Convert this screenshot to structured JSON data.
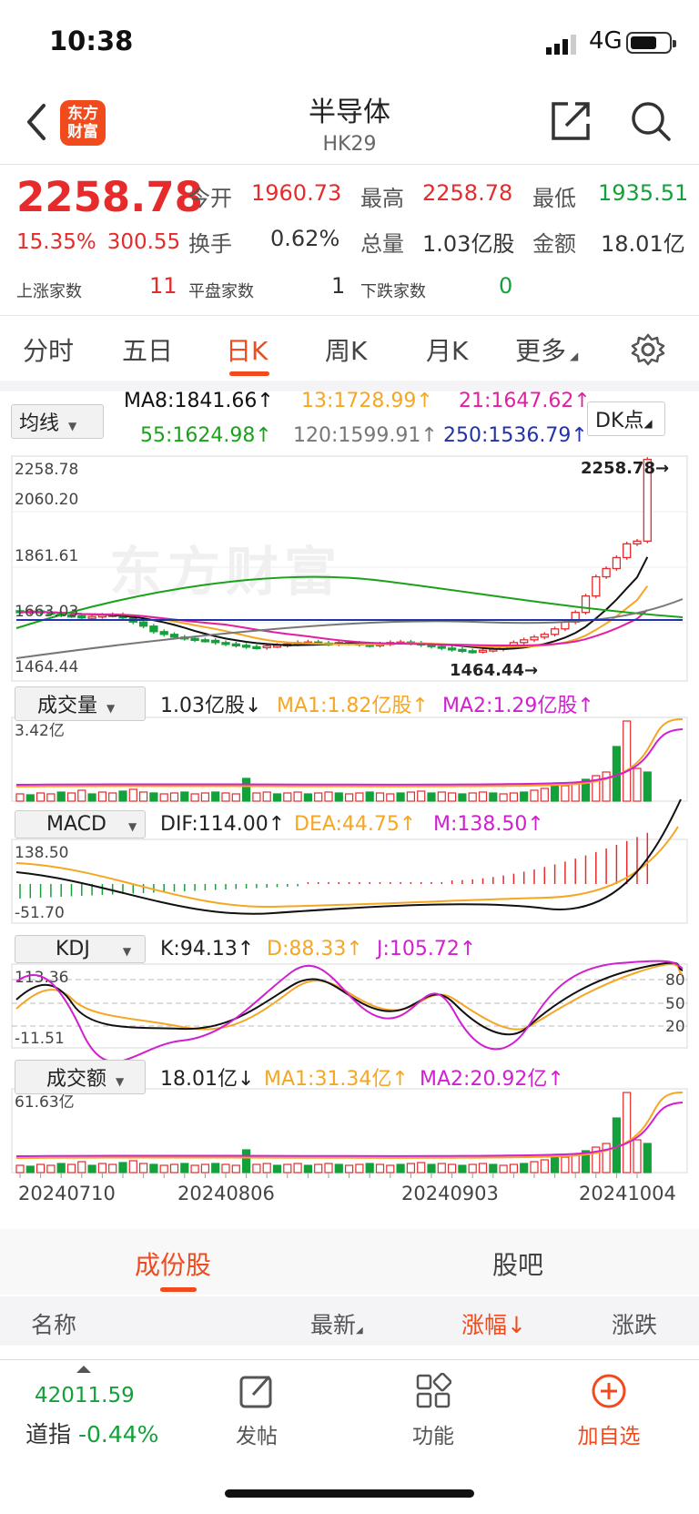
{
  "status_bar": {
    "time": "10:38",
    "network": "4G"
  },
  "header": {
    "title": "半导体",
    "code": "HK29",
    "logo_text": "东方财富"
  },
  "quote": {
    "price": "2258.78",
    "change_pct": "15.35%",
    "change": "300.55",
    "open_label": "今开",
    "open": "1960.73",
    "high_label": "最高",
    "high": "2258.78",
    "low_label": "最低",
    "low": "1935.51",
    "turnover_label": "换手",
    "turnover": "0.62%",
    "volume_label": "总量",
    "volume": "1.03亿股",
    "amount_label": "金额",
    "amount": "18.01亿",
    "up_label": "上涨家数",
    "up_count": "11",
    "flat_label": "平盘家数",
    "flat_count": "1",
    "down_label": "下跌家数",
    "down_count": "0"
  },
  "period_tabs": [
    "分时",
    "五日",
    "日K",
    "周K",
    "月K",
    "更多"
  ],
  "active_tab": "日K",
  "ma_panel": {
    "selector": "均线",
    "dk_label": "DK点",
    "ma8": "MA8:1841.66↑",
    "ma13": "13:1728.99↑",
    "ma21": "21:1647.62↑",
    "ma55": "55:1624.98↑",
    "ma120": "120:1599.91↑",
    "ma250": "250:1536.79↑"
  },
  "kline": {
    "y_labels": [
      "2258.78",
      "2060.20",
      "1861.61",
      "1663.03",
      "1464.44"
    ],
    "max_tag": "2258.78→",
    "min_tag": "1464.44→",
    "watermark": "东方财富",
    "colors": {
      "up": "#e52b2b",
      "down": "#13a13a",
      "ma8": "#111111",
      "ma13": "#f5a623",
      "ma21": "#e020a0",
      "ma55": "#1aa31a",
      "ma120": "#777777",
      "ma250": "#2233aa"
    }
  },
  "volume_panel": {
    "selector": "成交量",
    "value": "1.03亿股↓",
    "ma1": "MA1:1.82亿股↑",
    "ma2": "MA2:1.29亿股↑",
    "max": "3.42亿"
  },
  "macd_panel": {
    "selector": "MACD",
    "dif": "DIF:114.00↑",
    "dea": "DEA:44.75↑",
    "m": "M:138.50↑",
    "max": "138.50",
    "min": "-51.70"
  },
  "kdj_panel": {
    "selector": "KDJ",
    "k": "K:94.13↑",
    "d": "D:88.33↑",
    "j": "J:105.72↑",
    "max": "113.36",
    "min": "-11.51",
    "levels": [
      "80",
      "50",
      "20"
    ]
  },
  "amount_panel": {
    "selector": "成交额",
    "value": "18.01亿↓",
    "ma1": "MA1:31.34亿↑",
    "ma2": "MA2:20.92亿↑",
    "max": "61.63亿"
  },
  "x_dates": [
    "20240710",
    "20240806",
    "20240903",
    "20241004"
  ],
  "sub_tabs": [
    "成份股",
    "股吧"
  ],
  "columns": {
    "name": "名称",
    "latest": "最新",
    "change_pct": "涨幅↓",
    "change": "涨跌"
  },
  "bottom_bar": {
    "index_value": "42011.59",
    "index_name": "道指",
    "index_change": "-0.44%",
    "post": "发帖",
    "func": "功能",
    "add": "加自选"
  }
}
